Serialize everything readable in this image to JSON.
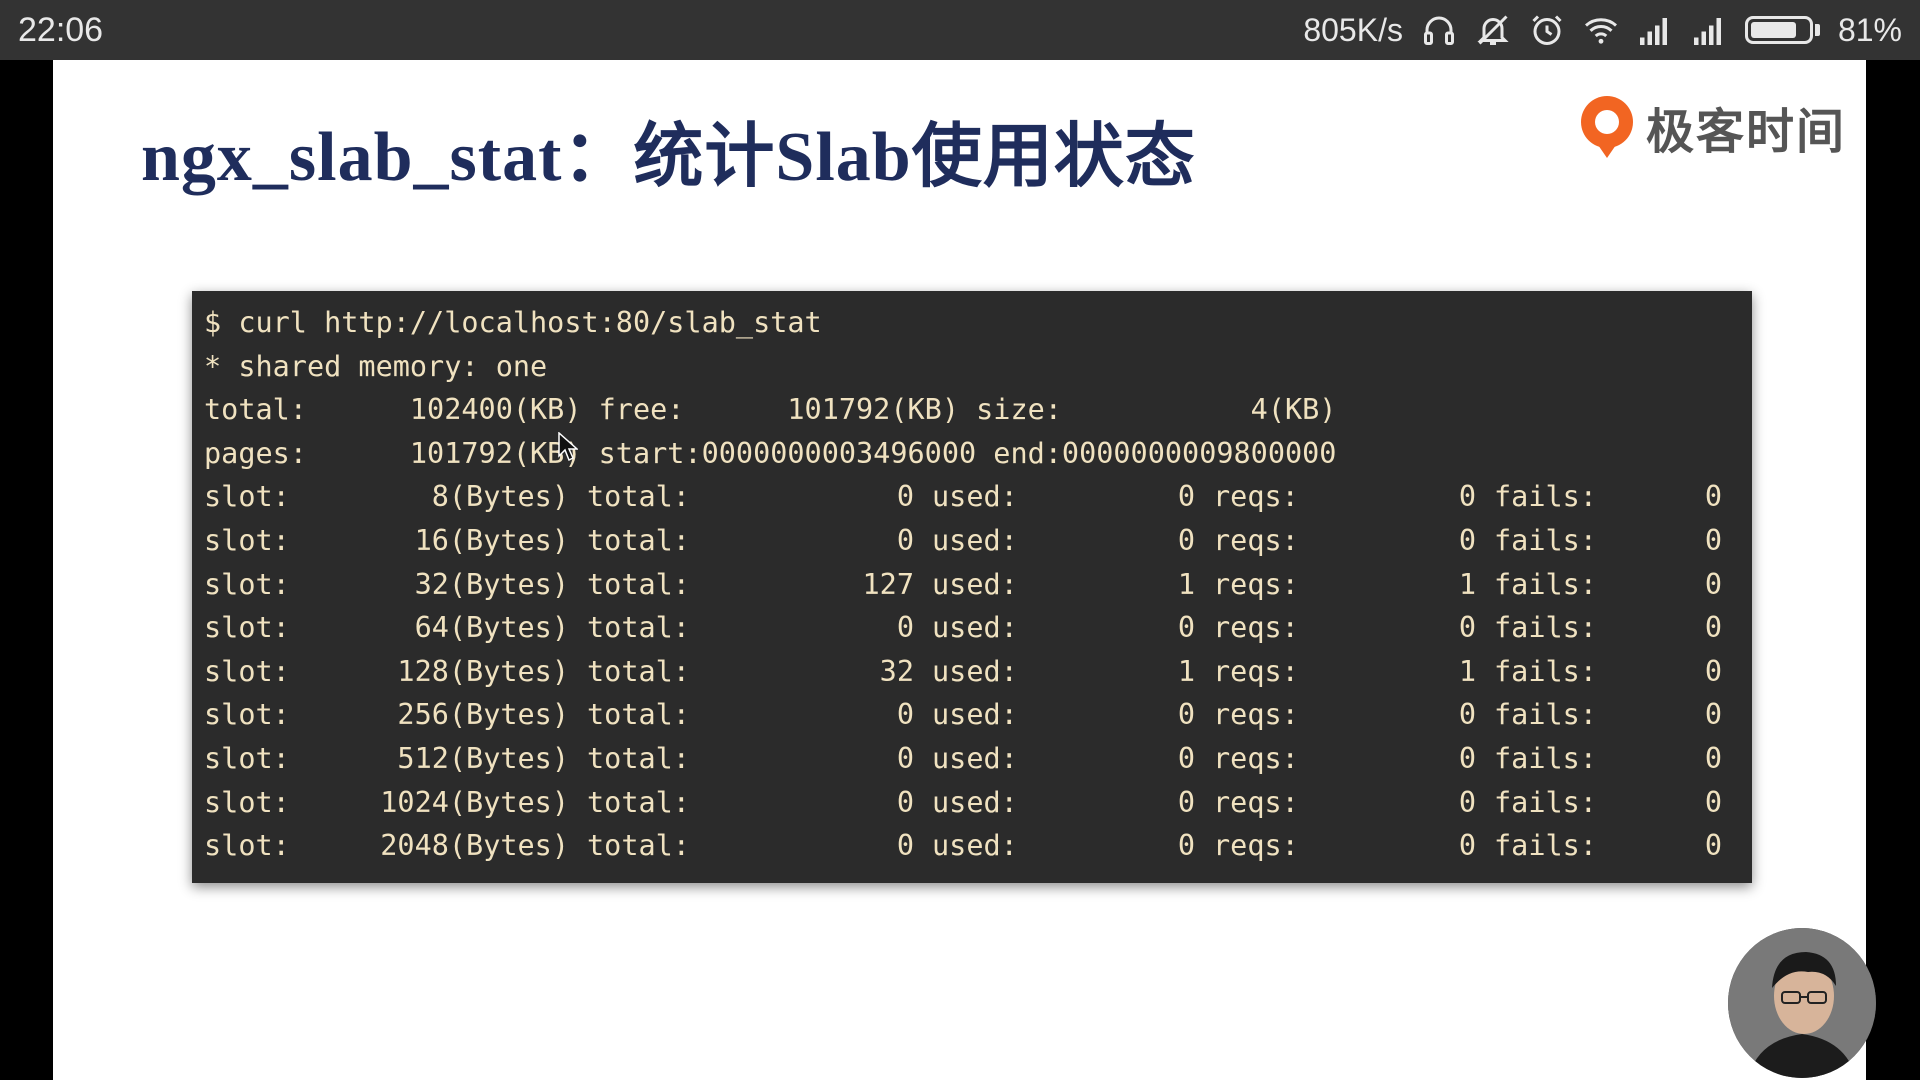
{
  "status_bar": {
    "time": "22:06",
    "network_speed": "805K/s",
    "battery_percent": "81%",
    "battery_level": 0.81,
    "icons": [
      "headset-icon",
      "silent-bell-icon",
      "alarm-icon",
      "wifi-icon",
      "signal-icon",
      "signal-icon-2",
      "battery-icon"
    ]
  },
  "slide": {
    "title": "ngx_slab_stat：统计Slab使用状态",
    "logo_text": "极客时间",
    "brand_color": "#f26522",
    "title_color": "#1f2d5c"
  },
  "terminal": {
    "command": "$ curl http://localhost:80/slab_stat",
    "shared_memory": "* shared memory: one",
    "summary_line1": "total:      102400(KB) free:      101792(KB) size:           4(KB)",
    "summary_line2": "pages:      101792(KB) start:0000000003496000 end:0000000009800000",
    "slots": [
      {
        "label": "slot:",
        "size": "8(Bytes)",
        "total_label": "total:",
        "total": "0",
        "used_label": "used:",
        "used": "0",
        "reqs_label": "reqs:",
        "reqs": "0",
        "fails_label": "fails:",
        "fails": "0"
      },
      {
        "label": "slot:",
        "size": "16(Bytes)",
        "total_label": "total:",
        "total": "0",
        "used_label": "used:",
        "used": "0",
        "reqs_label": "reqs:",
        "reqs": "0",
        "fails_label": "fails:",
        "fails": "0"
      },
      {
        "label": "slot:",
        "size": "32(Bytes)",
        "total_label": "total:",
        "total": "127",
        "used_label": "used:",
        "used": "1",
        "reqs_label": "reqs:",
        "reqs": "1",
        "fails_label": "fails:",
        "fails": "0"
      },
      {
        "label": "slot:",
        "size": "64(Bytes)",
        "total_label": "total:",
        "total": "0",
        "used_label": "used:",
        "used": "0",
        "reqs_label": "reqs:",
        "reqs": "0",
        "fails_label": "fails:",
        "fails": "0"
      },
      {
        "label": "slot:",
        "size": "128(Bytes)",
        "total_label": "total:",
        "total": "32",
        "used_label": "used:",
        "used": "1",
        "reqs_label": "reqs:",
        "reqs": "1",
        "fails_label": "fails:",
        "fails": "0"
      },
      {
        "label": "slot:",
        "size": "256(Bytes)",
        "total_label": "total:",
        "total": "0",
        "used_label": "used:",
        "used": "0",
        "reqs_label": "reqs:",
        "reqs": "0",
        "fails_label": "fails:",
        "fails": "0"
      },
      {
        "label": "slot:",
        "size": "512(Bytes)",
        "total_label": "total:",
        "total": "0",
        "used_label": "used:",
        "used": "0",
        "reqs_label": "reqs:",
        "reqs": "0",
        "fails_label": "fails:",
        "fails": "0"
      },
      {
        "label": "slot:",
        "size": "1024(Bytes)",
        "total_label": "total:",
        "total": "0",
        "used_label": "used:",
        "used": "0",
        "reqs_label": "reqs:",
        "reqs": "0",
        "fails_label": "fails:",
        "fails": "0"
      },
      {
        "label": "slot:",
        "size": "2048(Bytes)",
        "total_label": "total:",
        "total": "0",
        "used_label": "used:",
        "used": "0",
        "reqs_label": "reqs:",
        "reqs": "0",
        "fails_label": "fails:",
        "fails": "0"
      }
    ]
  }
}
